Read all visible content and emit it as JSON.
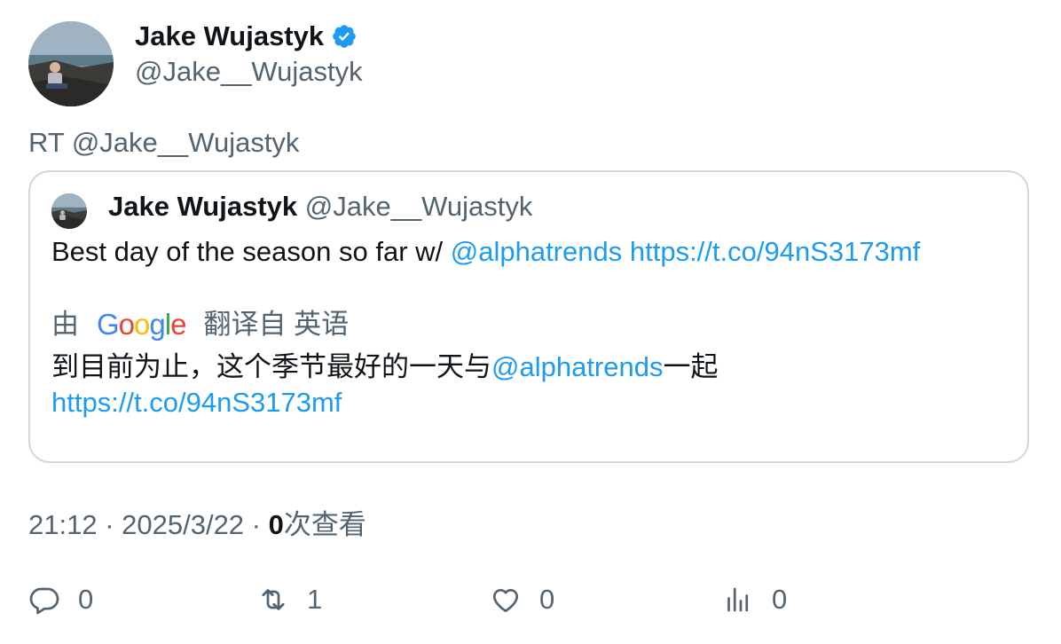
{
  "author": {
    "name": "Jake Wujastyk",
    "handle": "@Jake__Wujastyk",
    "verified_icon": "verified-badge-icon"
  },
  "retweet_line": "RT @Jake__Wujastyk",
  "quoted": {
    "name": "Jake Wujastyk",
    "handle": "@Jake__Wujastyk",
    "text_prefix": "Best day of the season so far w/ ",
    "mention": "@alphatrends",
    "url": "https://t.co/94nS3173mf",
    "translate": {
      "by": "由",
      "provider": "Google",
      "from": "翻译自 英语"
    },
    "translated_prefix": "到目前为止，这个季节最好的一天与",
    "translated_mention": "@alphatrends",
    "translated_suffix": "一起",
    "translated_url": "https://t.co/94nS3173mf"
  },
  "meta": {
    "time": "21:12",
    "sep1": " · ",
    "date": "2025/3/22",
    "sep2": " · ",
    "views_count": "0",
    "views_label": "次查看"
  },
  "actions": {
    "reply": "0",
    "retweet": "1",
    "like": "0",
    "views": "0"
  },
  "colors": {
    "link": "#1d9bf0",
    "muted": "#536471",
    "verified": "#1d9bf0"
  }
}
